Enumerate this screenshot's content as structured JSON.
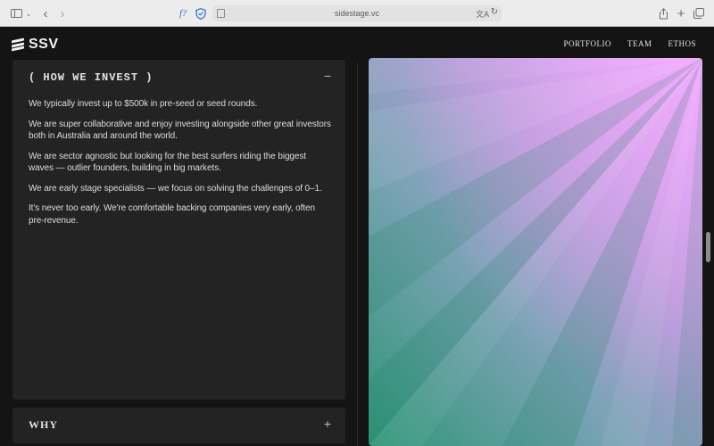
{
  "browser": {
    "url": "sidestage.vc",
    "icons": [
      "sidebar-icon",
      "chevron-down-icon",
      "back-icon",
      "forward-icon",
      "extension-f-icon",
      "shield-icon",
      "page-icon",
      "translate-icon",
      "reload-icon",
      "share-icon",
      "new-tab-icon",
      "tabs-overview-icon"
    ],
    "extension_label": "f?"
  },
  "site": {
    "logo_text": "SSV",
    "nav": [
      "PORTFOLIO",
      "TEAM",
      "ETHOS"
    ]
  },
  "invest_panel": {
    "title": "( HOW WE INVEST )",
    "toggle": "−",
    "paragraphs": [
      "We typically invest up to $500k in pre-seed or seed rounds.",
      "We are super collaborative and enjoy investing alongside other great investors both in Australia and around the world.",
      "We are sector agnostic but looking for the best surfers riding the biggest waves — outlier founders, building in big markets.",
      "We are early stage specialists — we focus on solving the challenges of 0–1.",
      "It's never too early. We're comfortable backing companies very early, often pre-revenue."
    ]
  },
  "why_panel": {
    "title": "WHY",
    "toggle": "+"
  },
  "colors": {
    "background": "#141414",
    "panel": "#232323",
    "art_pink": "#e79bf5",
    "art_green": "#2f9a7a"
  }
}
